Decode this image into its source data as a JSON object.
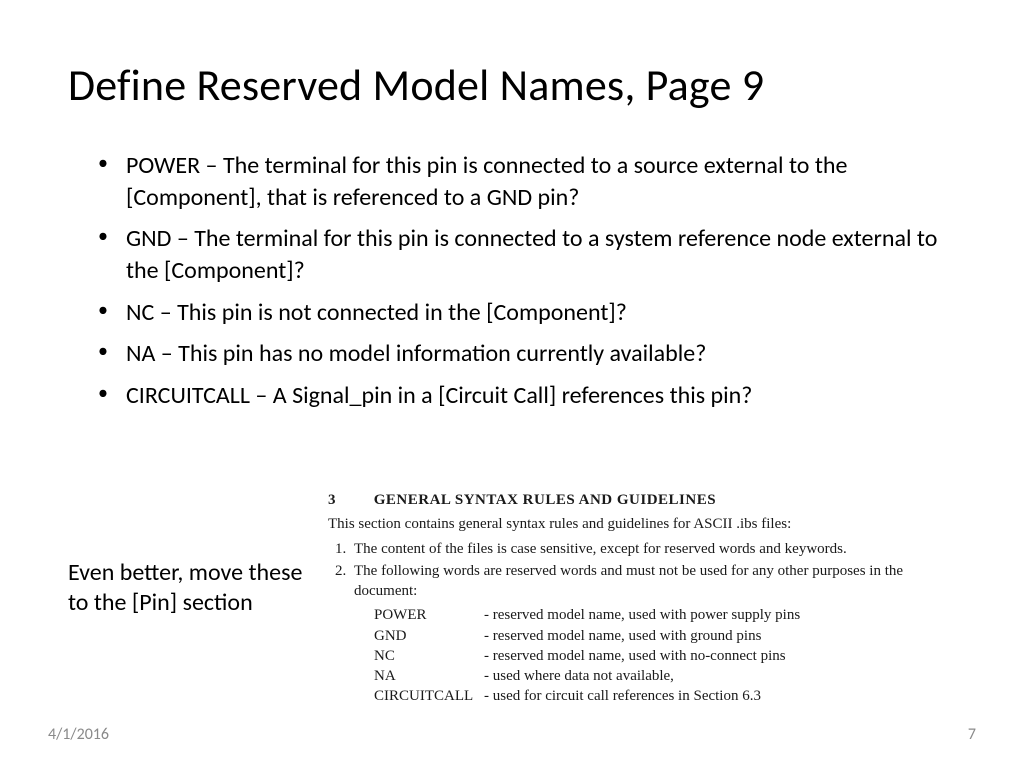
{
  "title": "Define Reserved Model Names, Page 9",
  "bullets": [
    "POWER – The terminal for this pin is connected to a source external to the [Component], that is referenced to a GND pin?",
    "GND – The terminal for this pin is connected to a system reference node external to the [Component]?",
    "NC – This pin is not connected in the [Component]?",
    "NA – This pin has no model information currently available?",
    "CIRCUITCALL – A Signal_pin in a [Circuit Call] references this pin?"
  ],
  "note": "Even better, move these to the [Pin] section",
  "excerpt": {
    "section_number": "3",
    "section_title": "GENERAL SYNTAX RULES AND GUIDELINES",
    "intro": "This section contains general syntax rules and guidelines for ASCII .ibs files:",
    "items": [
      "The content of the files is case sensitive, except for reserved words and keywords.",
      "The following words are reserved words and must not be used for any other purposes in the document:"
    ],
    "reserved": [
      {
        "word": "POWER",
        "desc": "reserved model name, used with power supply pins"
      },
      {
        "word": "GND",
        "desc": "reserved model name, used with ground pins"
      },
      {
        "word": "NC",
        "desc": "reserved model name, used with no-connect pins"
      },
      {
        "word": "NA",
        "desc": "used where data not available,"
      },
      {
        "word": "CIRCUITCALL",
        "desc": "used for circuit call references in Section 6.3"
      }
    ]
  },
  "footer": {
    "date": "4/1/2016",
    "page": "7"
  }
}
